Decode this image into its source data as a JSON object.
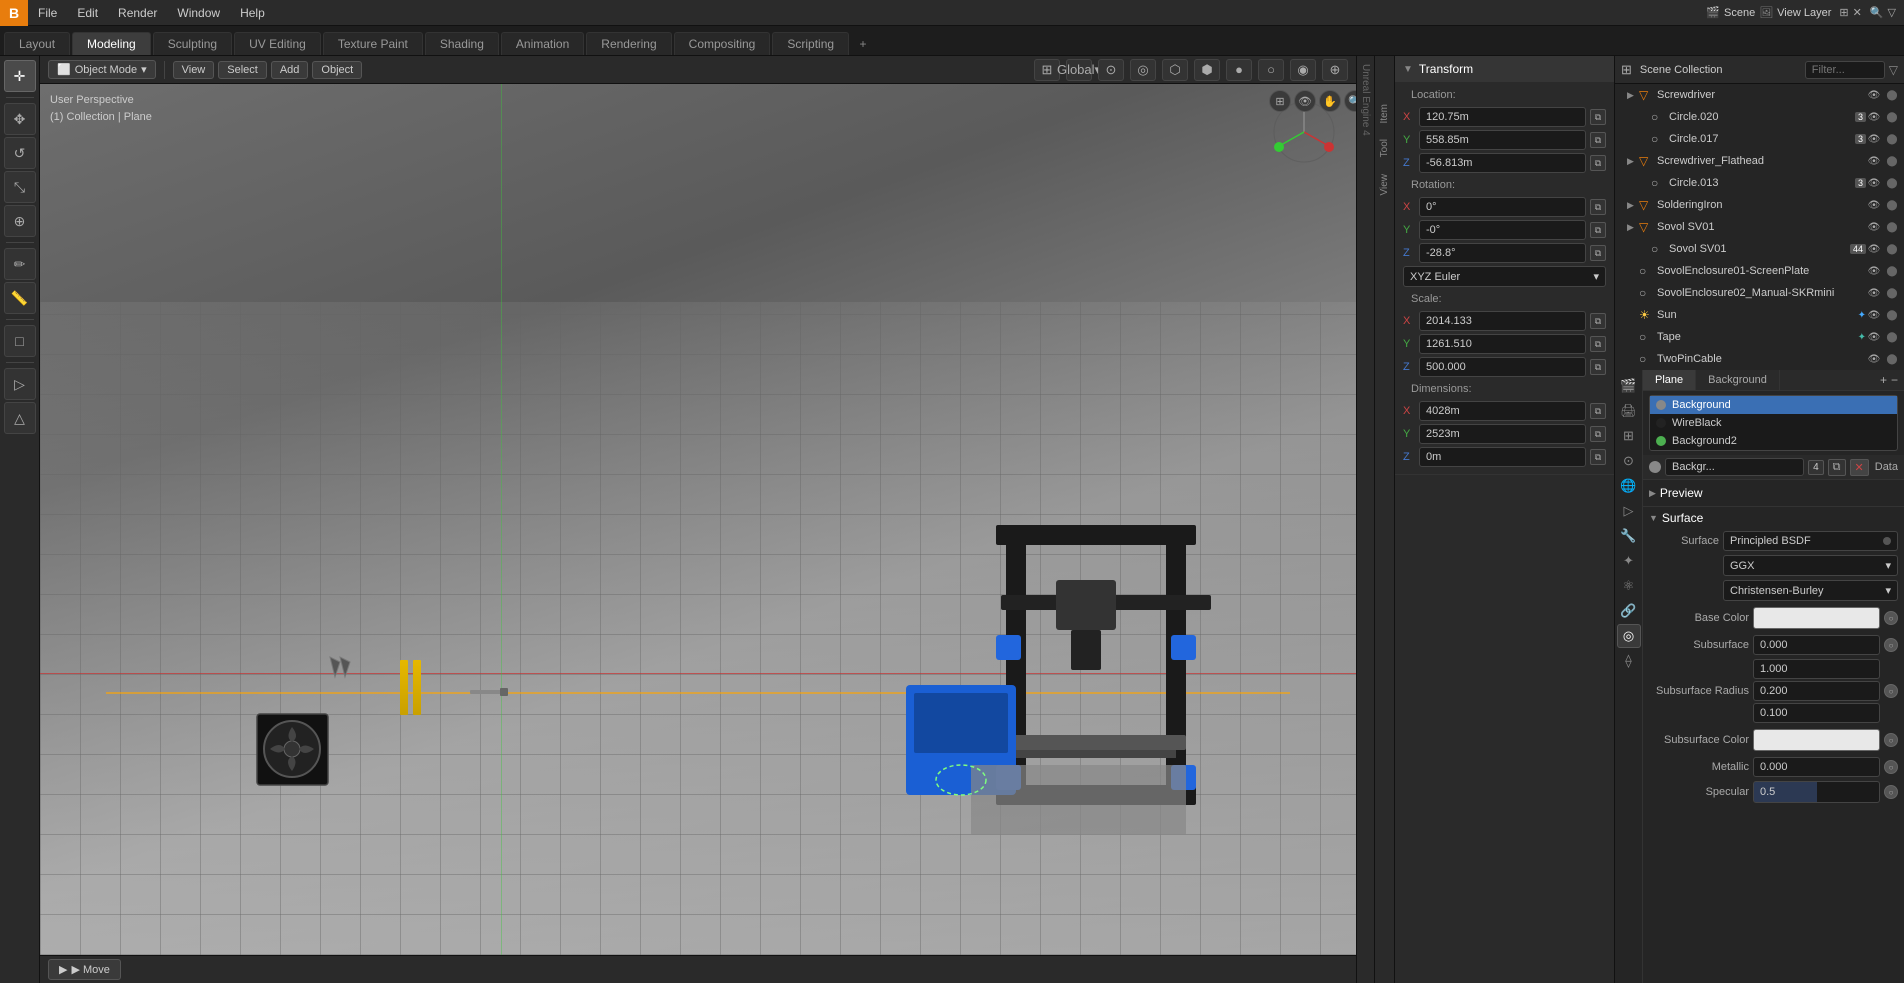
{
  "app": {
    "logo": "B",
    "menus": [
      "File",
      "Edit",
      "Render",
      "Window",
      "Help"
    ]
  },
  "workspaces": {
    "tabs": [
      "Layout",
      "Modeling",
      "Sculpting",
      "UV Editing",
      "Texture Paint",
      "Shading",
      "Animation",
      "Rendering",
      "Compositing",
      "Scripting"
    ],
    "active": "Modeling",
    "add_label": "+"
  },
  "viewport": {
    "header": {
      "object_mode": "Object Mode",
      "view": "View",
      "select": "Select",
      "add": "Add",
      "object": "Object",
      "global": "Global"
    },
    "info": {
      "perspective": "User Perspective",
      "collection": "(1) Collection | Plane"
    },
    "bottom": {
      "move_label": "▶ Move"
    }
  },
  "toolbar": {
    "tools": [
      "cursor",
      "move",
      "rotate",
      "scale",
      "transform",
      "annotate",
      "measure",
      "add_cube",
      "paint"
    ]
  },
  "transform_panel": {
    "header": "Transform",
    "location": {
      "label": "Location:",
      "x": "120.75m",
      "y": "558.85m",
      "z": "-56.813m"
    },
    "rotation": {
      "label": "Rotation:",
      "x": "0°",
      "y": "-0°",
      "z": "-28.8°"
    },
    "xyz_euler": "XYZ Euler",
    "scale": {
      "label": "Scale:",
      "x": "2014.133",
      "y": "1261.510",
      "z": "500.000"
    },
    "dimensions": {
      "label": "Dimensions:",
      "x": "4028m",
      "y": "2523m",
      "z": "0m"
    }
  },
  "outliner": {
    "search_placeholder": "Filter...",
    "items": [
      {
        "label": "Screwdriver",
        "icon": "▶",
        "type": "mesh",
        "indent": 0,
        "badge": null,
        "visible": true
      },
      {
        "label": "Circle.020",
        "icon": "○",
        "type": "mesh",
        "indent": 1,
        "badge": "3",
        "visible": true
      },
      {
        "label": "Circle.017",
        "icon": "○",
        "type": "mesh",
        "indent": 1,
        "badge": "3",
        "visible": true
      },
      {
        "label": "Screwdriver_Flathead",
        "icon": "▶",
        "type": "mesh",
        "indent": 0,
        "badge": null,
        "visible": true
      },
      {
        "label": "Circle.013",
        "icon": "○",
        "type": "mesh",
        "indent": 1,
        "badge": "3",
        "visible": true
      },
      {
        "label": "SolderingIron",
        "icon": "▶",
        "type": "mesh",
        "indent": 0,
        "badge": null,
        "visible": true
      },
      {
        "label": "Sovol SV01",
        "icon": "▶",
        "type": "mesh",
        "indent": 0,
        "badge": null,
        "visible": true
      },
      {
        "label": "Sovol SV01",
        "icon": "○",
        "type": "mesh",
        "indent": 1,
        "badge": "44",
        "visible": true
      },
      {
        "label": "SovolEnclosure01-ScreenPlate",
        "icon": "○",
        "type": "mesh",
        "indent": 0,
        "badge": null,
        "visible": true
      },
      {
        "label": "SovolEnclosure02_Manual-SKRmini",
        "icon": "○",
        "type": "mesh",
        "indent": 0,
        "badge": null,
        "visible": true
      },
      {
        "label": "Sun",
        "icon": "☀",
        "type": "light",
        "indent": 0,
        "badge": null,
        "visible": true
      },
      {
        "label": "Tape",
        "icon": "○",
        "type": "mesh",
        "indent": 0,
        "badge": null,
        "visible": true
      },
      {
        "label": "TwoPinCable",
        "icon": "○",
        "type": "mesh",
        "indent": 0,
        "badge": null,
        "visible": true
      }
    ]
  },
  "viewport_tabs": {
    "plane_label": "Plane",
    "background_label": "Background"
  },
  "material_panel": {
    "preview_label": "Preview",
    "surface_label": "Surface",
    "materials": [
      {
        "label": "Background",
        "color": "#888888",
        "selected": true
      },
      {
        "label": "WireBlack",
        "color": "#222222"
      },
      {
        "label": "Background2",
        "color": "#4caf50"
      }
    ],
    "node_name": "Backgr...",
    "node_count": "4",
    "data_label": "Data",
    "surface_type": "Principled BSDF",
    "distribution": "GGX",
    "subsurface_method": "Christensen-Burley",
    "base_color_label": "Base Color",
    "base_color_value": "",
    "subsurface_label": "Subsurface",
    "subsurface_value": "0.000",
    "subsurface_radius_label": "Subsurface Radius",
    "subsurface_radius_values": [
      "1.000",
      "0.200",
      "0.100"
    ],
    "subsurface_color_label": "Subsurface Color",
    "metallic_label": "Metallic",
    "metallic_value": "0.000",
    "specular_label": "Specular",
    "specular_value": "0.5"
  },
  "scene": {
    "label": "Scene",
    "name": "Scene"
  },
  "view_layer": {
    "label": "View Layer",
    "name": "View Layer"
  },
  "icons": {
    "eye": "👁",
    "arrow_right": "▶",
    "arrow_down": "▼",
    "chevron": "›",
    "copy": "⧉",
    "plus": "+",
    "minus": "−",
    "x": "✕",
    "search": "🔍",
    "filter": "☰"
  }
}
